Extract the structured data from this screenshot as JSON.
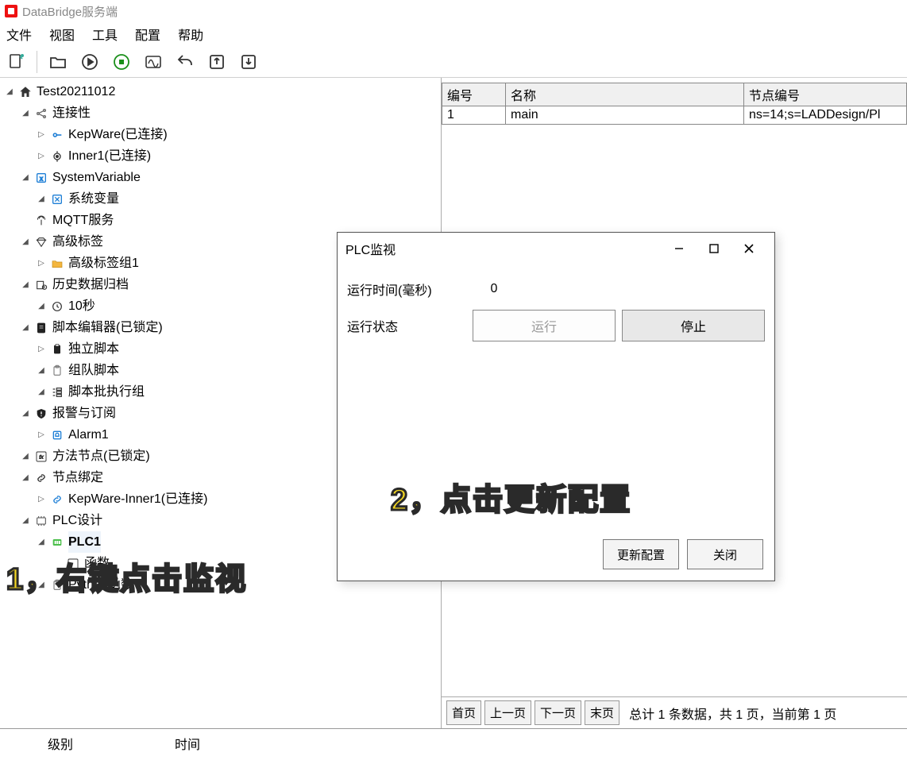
{
  "window": {
    "title": "DataBridge服务端"
  },
  "menu": {
    "file": "文件",
    "view": "视图",
    "tools": "工具",
    "config": "配置",
    "help": "帮助"
  },
  "tree": {
    "root": "Test20211012",
    "connectivity": "连接性",
    "kepware": "KepWare(已连接)",
    "inner1": "Inner1(已连接)",
    "sysvar": "SystemVariable",
    "sysvar_child": "系统变量",
    "mqtt": "MQTT服务",
    "advtag": "高级标签",
    "advtag_group": "高级标签组1",
    "history": "历史数据归档",
    "history_10s": "10秒",
    "script_editor": "脚本编辑器(已锁定)",
    "script_standalone": "独立脚本",
    "script_team": "组队脚本",
    "script_batch": "脚本批执行组",
    "alarm": "报警与订阅",
    "alarm1": "Alarm1",
    "method_node": "方法节点(已锁定)",
    "node_bind": "节点绑定",
    "kepware_inner": "KepWare-Inner1(已连接)",
    "plc_design": "PLC设计",
    "plc1": "PLC1",
    "func_hidden": "函数",
    "python_func": "Python函数"
  },
  "grid": {
    "col_id": "编号",
    "col_name": "名称",
    "col_node": "节点编号",
    "rows": [
      {
        "id": "1",
        "name": "main",
        "node": "ns=14;s=LADDesign/Pl"
      }
    ]
  },
  "pager": {
    "first": "首页",
    "prev": "上一页",
    "next": "下一页",
    "last": "末页",
    "info": "总计 1 条数据，共 1 页，当前第 1 页"
  },
  "log": {
    "level": "级别",
    "time": "时间"
  },
  "dialog": {
    "title": "PLC监视",
    "runtime_label": "运行时间(毫秒)",
    "runtime_value": "0",
    "state_label": "运行状态",
    "run_btn": "运行",
    "stop_btn": "停止",
    "update_btn": "更新配置",
    "close_btn": "关闭"
  },
  "anno": {
    "a1": "1，右键点击监视",
    "a2": "2，点击更新配置"
  }
}
